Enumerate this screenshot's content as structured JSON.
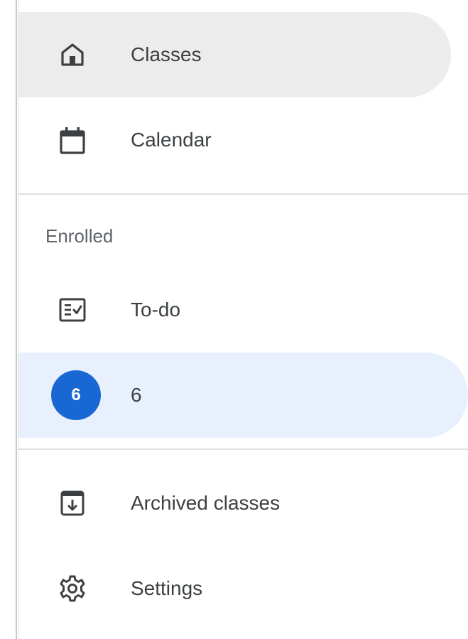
{
  "nav": {
    "items_top": [
      {
        "label": "Classes",
        "icon": "home-icon"
      },
      {
        "label": "Calendar",
        "icon": "calendar-icon"
      }
    ],
    "section_header": "Enrolled",
    "items_enrolled": [
      {
        "label": "To-do",
        "icon": "todo-icon"
      },
      {
        "label": "6",
        "avatar_text": "6"
      }
    ],
    "items_bottom": [
      {
        "label": "Archived classes",
        "icon": "archive-icon"
      },
      {
        "label": "Settings",
        "icon": "gear-icon"
      }
    ]
  },
  "colors": {
    "selected_gray": "#ececec",
    "selected_blue": "#e8f0fe",
    "avatar_blue": "#1967d2",
    "text": "#3c4043",
    "muted": "#5f6368",
    "divider": "#e0e0e0"
  }
}
